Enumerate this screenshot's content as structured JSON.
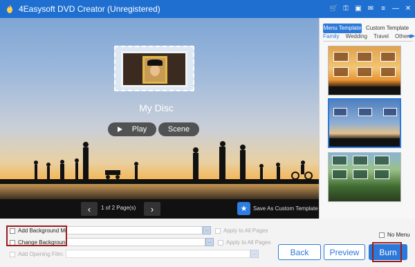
{
  "window": {
    "title": "4Easysoft DVD Creator (Unregistered)",
    "toolbar_icons": [
      "cart-icon",
      "key-icon",
      "register-icon",
      "feedback-icon",
      "menu-icon",
      "minimize-icon",
      "close-icon"
    ]
  },
  "preview": {
    "disc_title": "My Disc",
    "play_label": "Play",
    "scene_label": "Scene",
    "page_indicator": "1 of 2 Page(s)",
    "save_template_label": "Save As Custom Template"
  },
  "template_panel": {
    "tabs": [
      {
        "label": "Menu Template",
        "active": true
      },
      {
        "label": "Custom Template",
        "active": false
      }
    ],
    "categories": [
      {
        "label": "Family",
        "active": true
      },
      {
        "label": "Wedding",
        "active": false
      },
      {
        "label": "Travel",
        "active": false
      },
      {
        "label": "Others",
        "active": false
      }
    ],
    "thumbnails": [
      {
        "name": "sunset-family",
        "selected": false
      },
      {
        "name": "blue-sky-family",
        "selected": true
      },
      {
        "name": "park-family",
        "selected": false
      }
    ]
  },
  "options": {
    "bg_music_label": "Add Background Music:",
    "bg_music_apply": "Apply to All Pages",
    "bg_change_label": "Change Background:",
    "bg_change_apply": "Apply to All Pages",
    "opening_film_label": "Add Opening Film:",
    "browse_label": "...",
    "no_menu_label": "No Menu"
  },
  "actions": {
    "back": "Back",
    "preview": "Preview",
    "burn": "Burn"
  },
  "colors": {
    "accent": "#2c79d9",
    "titlebar": "#1f6fd1",
    "highlight_box": "#9b1b1b"
  }
}
